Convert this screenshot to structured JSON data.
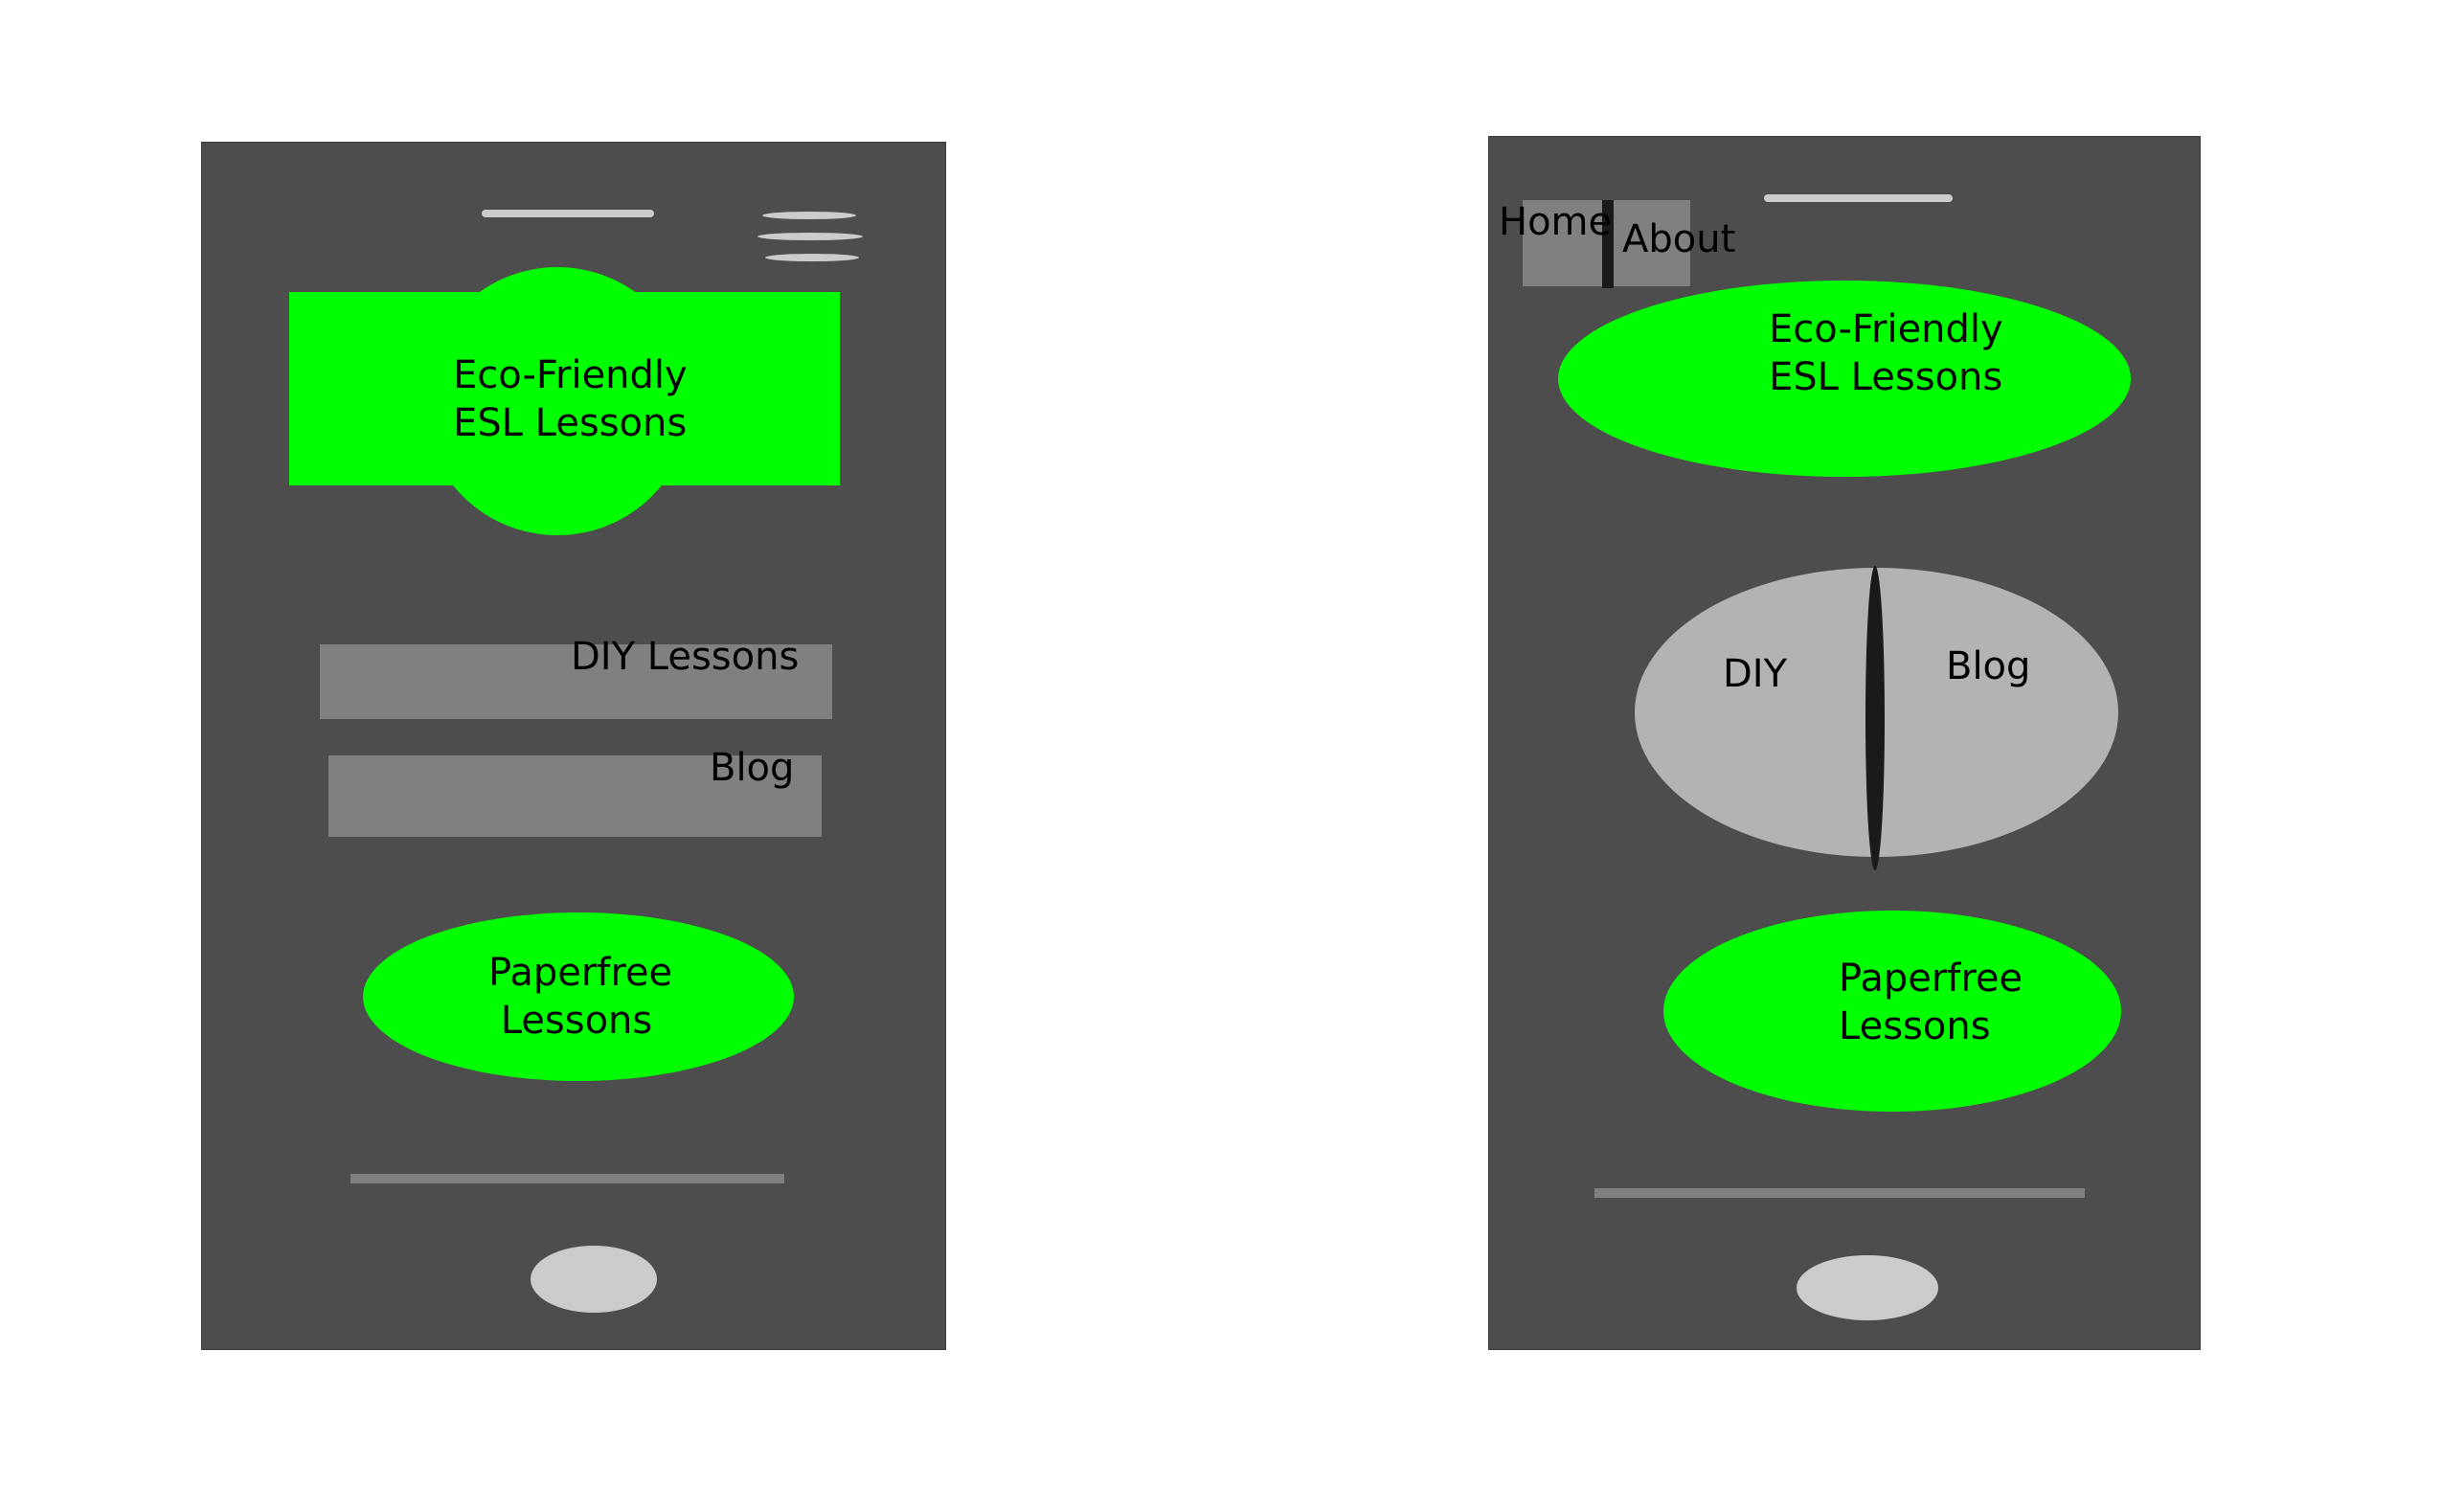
{
  "colors": {
    "phone_body": "#4d4d4d",
    "accent_green": "#00ff00",
    "bar_gray": "#808080",
    "light_gray": "#cccccc",
    "pill_gray": "#b3b3b3",
    "text": "#000000"
  },
  "mockup_a": {
    "hero": {
      "line1": "Eco-Friendly",
      "line2": "ESL Lessons"
    },
    "nav": {
      "diy_label": "DIY Lessons",
      "blog_label": "Blog"
    },
    "cta": {
      "line1": "Paperfree",
      "line2": " Lessons"
    },
    "icons": {
      "menu": "hamburger-menu-icon",
      "home": "home-button-icon"
    }
  },
  "mockup_b": {
    "tabs": {
      "home": "Home",
      "about": "About"
    },
    "hero": {
      "line1": "Eco-Friendly",
      "line2": "ESL Lessons"
    },
    "nav": {
      "diy_label": "DIY",
      "blog_label": "Blog"
    },
    "cta": {
      "line1": "Paperfree",
      "line2": "Lessons"
    },
    "icons": {
      "home": "home-button-icon"
    }
  }
}
